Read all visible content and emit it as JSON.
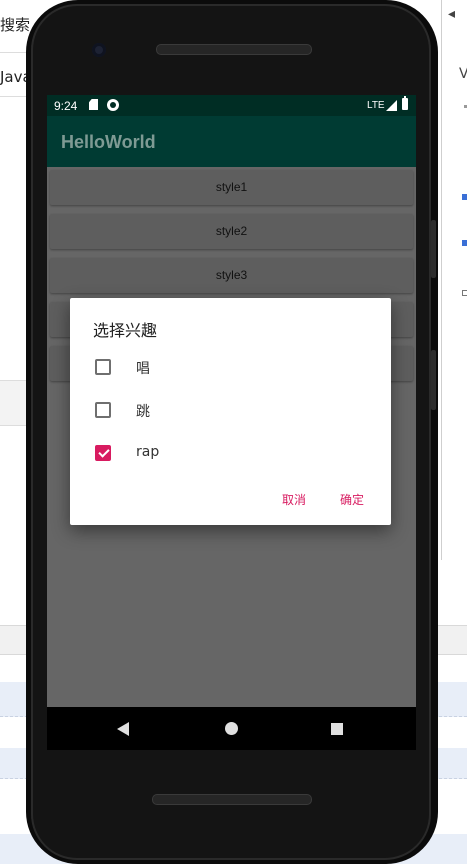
{
  "background": {
    "left_fragments": [
      "搜索",
      "Java"
    ],
    "right_fragments": [
      "◂",
      "V"
    ]
  },
  "status_bar": {
    "time": "9:24",
    "network": "LTE"
  },
  "app": {
    "title": "HelloWorld",
    "buttons": [
      "style1",
      "style2",
      "style3",
      "",
      ""
    ]
  },
  "dialog": {
    "title": "选择兴趣",
    "options": [
      {
        "label": "唱",
        "checked": false
      },
      {
        "label": "跳",
        "checked": false
      },
      {
        "label": "rap",
        "checked": true
      }
    ],
    "cancel_label": "取消",
    "ok_label": "确定",
    "accent_color": "#d81b60"
  },
  "colors": {
    "status_bar": "#002d24",
    "app_bar": "#003b33",
    "scrim_background": "#666666"
  },
  "icons": {
    "status": [
      "sd-card-icon",
      "sync-icon",
      "signal-icon",
      "battery-icon"
    ],
    "navigation": [
      "back-icon",
      "home-icon",
      "recents-icon"
    ]
  }
}
